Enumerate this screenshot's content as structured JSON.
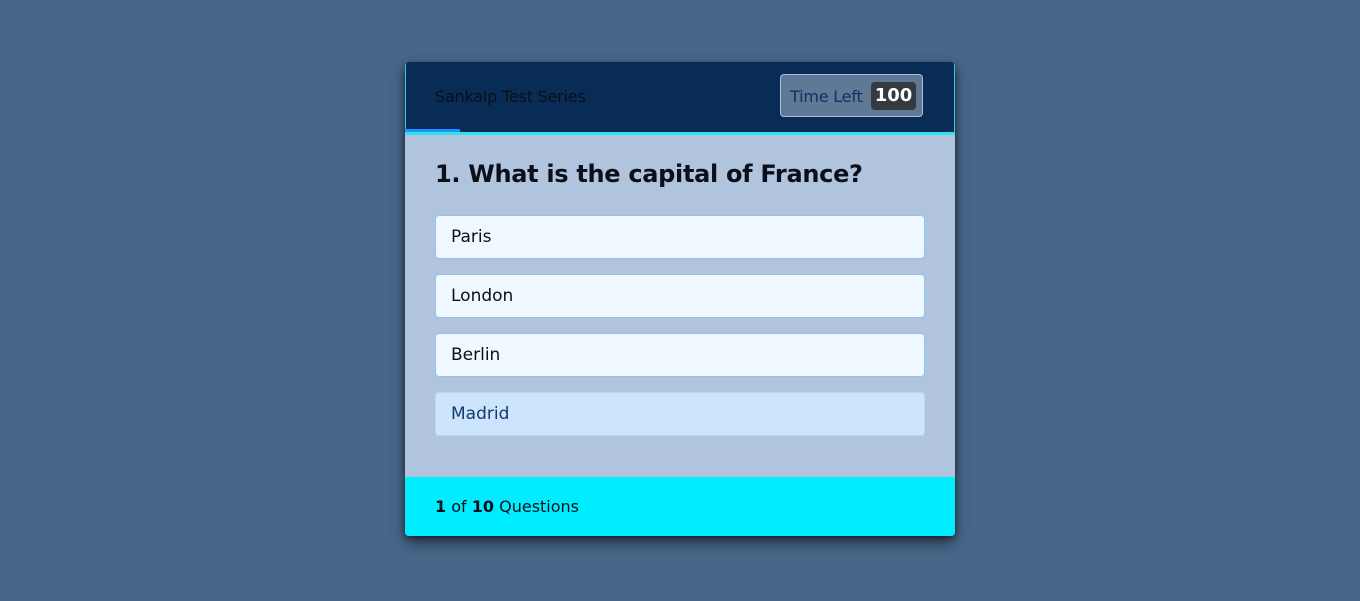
{
  "header": {
    "title": "Sankalp Test Series",
    "timer_label": "Time Left",
    "timer_value": "100"
  },
  "question": {
    "text": "1. What is the capital of France?",
    "options": [
      "Paris",
      "London",
      "Berlin",
      "Madrid"
    ]
  },
  "footer": {
    "current": "1",
    "of": "of",
    "total": "10",
    "suffix": "Questions"
  },
  "progress": {
    "fraction": 0.1
  },
  "colors": {
    "background": "#476688",
    "header": "#082c55",
    "card": "#b0c4de",
    "footer": "#00edff",
    "accent": "#31e2ee",
    "progress": "#1e90ff"
  }
}
